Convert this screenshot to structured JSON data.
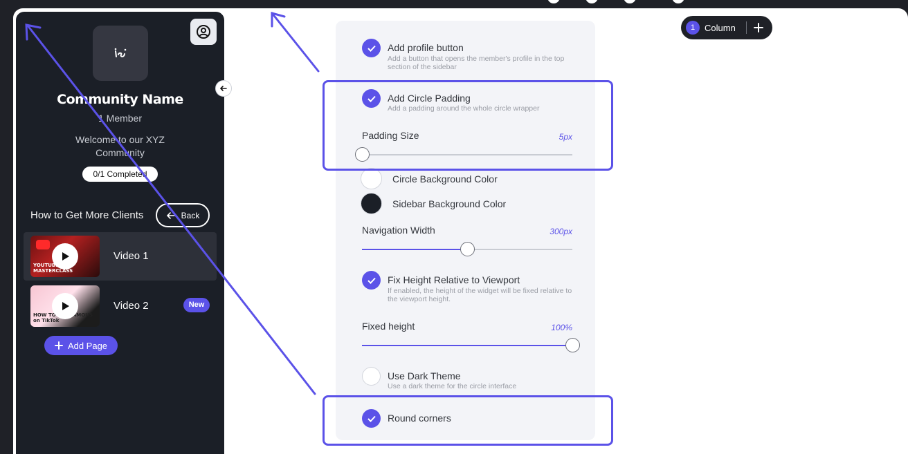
{
  "sidebar": {
    "community_name": "Community Name",
    "member_count": "1 Member",
    "welcome_text": "Welcome to our XYZ Community",
    "completed": "0/1 Completed",
    "section_title": "How to Get More Clients",
    "back_label": "Back",
    "videos": [
      {
        "label": "Video 1",
        "thumb_text": "YOUTUBE MASTERCLASS",
        "active": true
      },
      {
        "label": "Video 2",
        "thumb_text": "HOW TO GET FAMOUS on TikTok",
        "badge": "New",
        "active": false
      }
    ],
    "add_page_label": "Add Page"
  },
  "settings": {
    "profile_button": {
      "title": "Add profile button",
      "desc": "Add a button that opens the member's profile in the top section of the sidebar",
      "checked": true
    },
    "circle_padding": {
      "title": "Add Circle Padding",
      "desc": "Add a padding around the whole circle wrapper",
      "checked": true
    },
    "padding_size": {
      "label": "Padding Size",
      "value": "5px",
      "level": 0
    },
    "circle_bg": {
      "label": "Circle Background Color",
      "color": "#ffffff"
    },
    "sidebar_bg": {
      "label": "Sidebar Background Color",
      "color": "#1b1f27"
    },
    "nav_width": {
      "label": "Navigation Width",
      "value": "300px",
      "level": 0.5
    },
    "fix_height": {
      "title": "Fix Height Relative to Viewport",
      "desc": "If enabled, the height of the widget will be fixed relative to the viewport height.",
      "checked": true
    },
    "fixed_height": {
      "label": "Fixed height",
      "value": "100%",
      "level": 1.0
    },
    "dark_theme": {
      "title": "Use Dark Theme",
      "desc": "Use a dark theme for the circle interface",
      "checked": false
    },
    "round_corners": {
      "title": "Round corners",
      "checked": true
    }
  },
  "column_pill": {
    "number": "1",
    "label": "Column"
  },
  "colors": {
    "accent": "#5b52e8",
    "dark": "#1f2127",
    "panel": "#f3f4f8"
  }
}
